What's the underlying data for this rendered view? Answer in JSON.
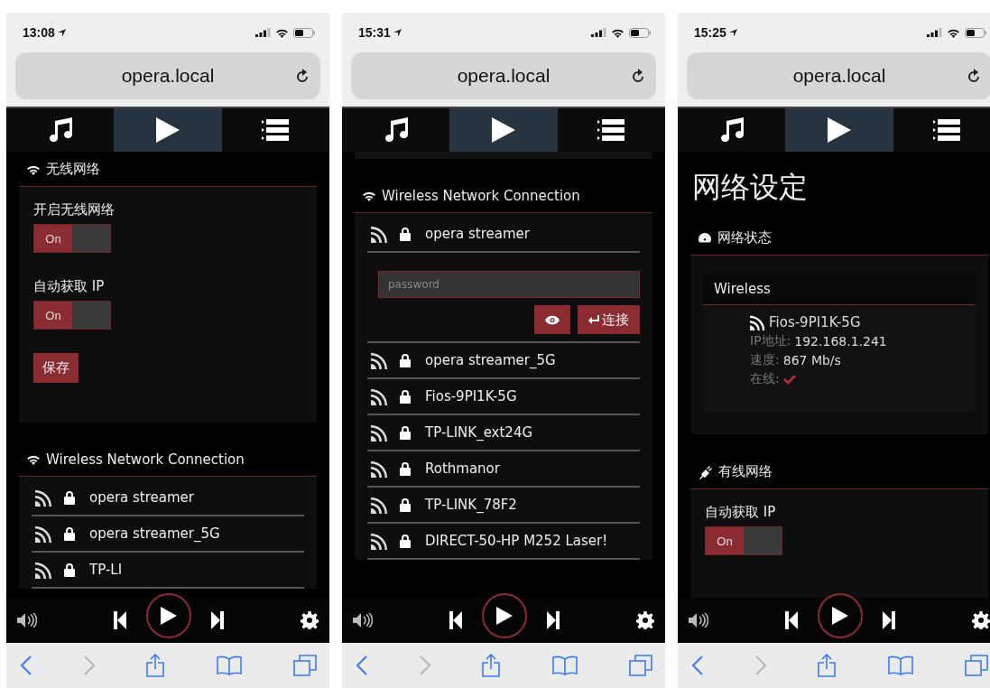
{
  "phones": [
    {
      "time": "13:08",
      "url": "opera.local",
      "tabs": [
        {
          "kind": "music",
          "selected": false
        },
        {
          "kind": "play",
          "selected": true
        },
        {
          "kind": "list",
          "selected": false
        }
      ],
      "sections": [
        {
          "kind": "wireless",
          "title": "无线网络",
          "fields": [
            {
              "label": "开启无线网络",
              "toggle": "On",
              "on": true
            },
            {
              "label": "自动获取 IP",
              "toggle": "On",
              "on": true
            }
          ],
          "button": "保存"
        },
        {
          "kind": "networks",
          "title": "Wireless Network Connection",
          "networks": [
            {
              "name": "opera streamer",
              "expanded": false
            },
            {
              "name": "opera streamer_5G",
              "expanded": false
            },
            {
              "name": "TP-LI",
              "expanded": false
            }
          ]
        }
      ],
      "nav": {
        "back_enabled": true,
        "forward_enabled": false
      }
    },
    {
      "time": "15:31",
      "url": "opera.local",
      "tabs": [
        {
          "kind": "music",
          "selected": false
        },
        {
          "kind": "play",
          "selected": true
        },
        {
          "kind": "list",
          "selected": false
        }
      ],
      "sections": [
        {
          "kind": "stub"
        },
        {
          "kind": "networks",
          "title": "Wireless Network Connection",
          "password_placeholder": "password",
          "connect_label": "连接",
          "networks": [
            {
              "name": "opera streamer",
              "expanded": true
            },
            {
              "name": "opera streamer_5G",
              "expanded": false
            },
            {
              "name": "Fios-9PI1K-5G",
              "expanded": false
            },
            {
              "name": "TP-LINK_ext24G",
              "expanded": false
            },
            {
              "name": "Rothmanor",
              "expanded": false
            },
            {
              "name": "TP-LINK_78F2",
              "expanded": false
            },
            {
              "name": "DIRECT-50-HP M252 Laser!",
              "expanded": false
            }
          ]
        }
      ],
      "nav": {
        "back_enabled": true,
        "forward_enabled": false
      }
    },
    {
      "time": "15:25",
      "url": "opera.local",
      "tabs": [
        {
          "kind": "music",
          "selected": false
        },
        {
          "kind": "play",
          "selected": true
        },
        {
          "kind": "list",
          "selected": false
        }
      ],
      "sections": [
        {
          "kind": "heading",
          "title": "网络设定"
        },
        {
          "kind": "status",
          "title": "网络状态",
          "card_title": "Wireless",
          "network": "Fios-9PI1K-5G",
          "rows": [
            {
              "kind": "text",
              "label": "IP地址:",
              "value": "192.168.1.241"
            },
            {
              "kind": "text",
              "label": "速度:",
              "value": "867 Mb/s"
            },
            {
              "kind": "check",
              "label": "在线:"
            }
          ]
        },
        {
          "kind": "wired",
          "title": "有线网络",
          "fields": [
            {
              "label": "自动获取 IP",
              "toggle": "On",
              "on": true
            }
          ]
        }
      ],
      "nav": {
        "back_enabled": true,
        "forward_enabled": false
      }
    }
  ]
}
